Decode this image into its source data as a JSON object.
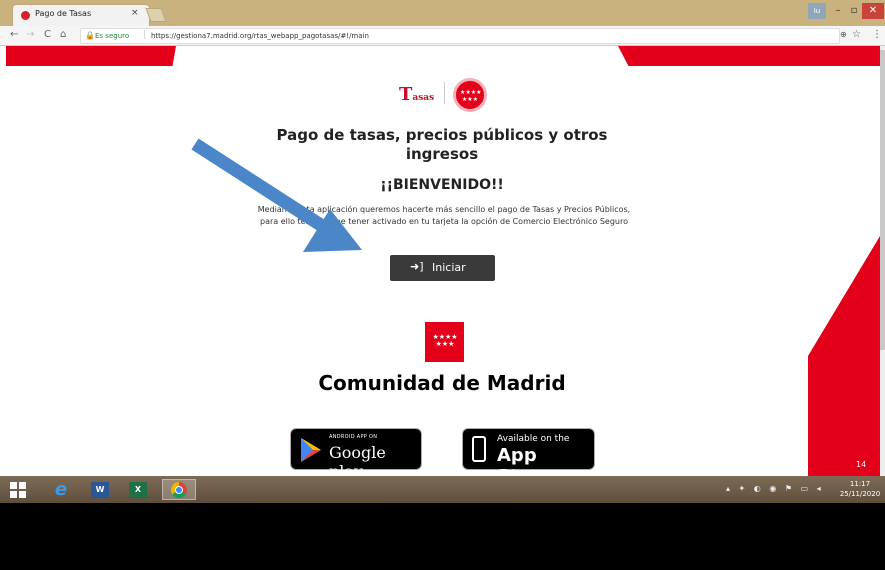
{
  "browser": {
    "tab_title": "Pago de Tasas",
    "tab_close": "×",
    "secure_label": "Es seguro",
    "url": "https://gestiona7.madrid.org/rtas_webapp_pagotasas/#!/main",
    "user_badge": "Iu"
  },
  "page": {
    "logo_big": "T",
    "logo_small": "asas",
    "title": "Pago de tasas, precios públicos y otros ingresos",
    "welcome": "¡¡BIENVENIDO!!",
    "intro": "Mediante esta aplicación queremos hacerte más sencillo el pago de Tasas y Precios Públicos, para ello tendrás que tener activado en tu tarjeta la opción de Comercio Electrónico Seguro",
    "start_button": "Iniciar",
    "organization": "Comunidad de Madrid",
    "google_play_small": "ANDROID APP ON",
    "google_play_big": "Google play",
    "app_store_small": "Available on the",
    "app_store_big": "App Store",
    "page_number": "14"
  },
  "taskbar": {
    "time": "11:17",
    "date": "25/11/2020"
  },
  "colors": {
    "brand_red": "#e2001a",
    "annotation_arrow": "#4a86c8"
  }
}
